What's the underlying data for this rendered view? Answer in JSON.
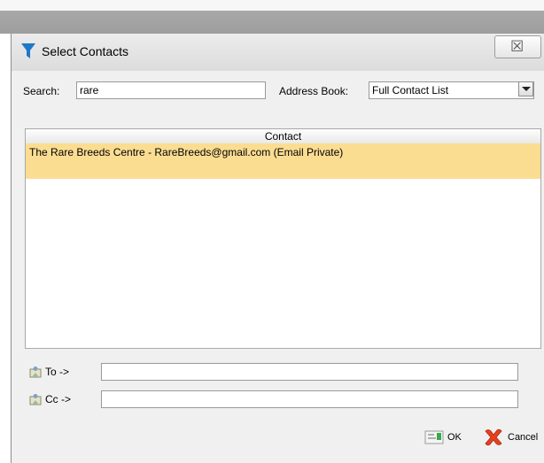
{
  "dialog": {
    "title": "Select Contacts",
    "close_glyph": "☒"
  },
  "search": {
    "label": "Search:",
    "value": "rare"
  },
  "address_book": {
    "label": "Address Book:",
    "selected": "Full Contact List"
  },
  "contacts": {
    "column_header": "Contact",
    "rows": [
      "The Rare Breeds Centre - RareBreeds@gmail.com (Email Private)"
    ]
  },
  "recipients": {
    "to_label": "To ->",
    "to_value": "",
    "cc_label": "Cc ->",
    "cc_value": ""
  },
  "buttons": {
    "ok_label": "OK",
    "cancel_label": "Cancel"
  },
  "colors": {
    "selected_row": "#fbdd92",
    "title_icon": "#1e78c8",
    "cancel_icon": "#e8401c"
  }
}
